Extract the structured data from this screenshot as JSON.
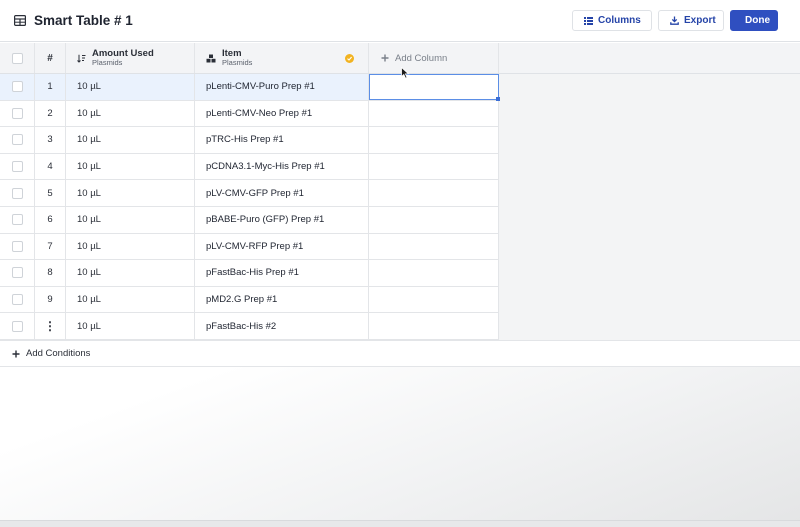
{
  "header": {
    "title": "Smart Table # 1",
    "columns_label": "Columns",
    "export_label": "Export",
    "done_label": "Done"
  },
  "table": {
    "columns": {
      "number": "#",
      "amount": {
        "label": "Amount Used",
        "sub": "Plasmids"
      },
      "item": {
        "label": "Item",
        "sub": "Plasmids"
      },
      "add_column": "Add Column"
    },
    "rows": [
      {
        "num": "1",
        "amount": "10 µL",
        "item": "pLenti-CMV-Puro Prep #1"
      },
      {
        "num": "2",
        "amount": "10 µL",
        "item": "pLenti-CMV-Neo Prep #1"
      },
      {
        "num": "3",
        "amount": "10 µL",
        "item": "pTRC-His Prep #1"
      },
      {
        "num": "4",
        "amount": "10 µL",
        "item": "pCDNA3.1-Myc-His Prep #1"
      },
      {
        "num": "5",
        "amount": "10 µL",
        "item": "pLV-CMV-GFP Prep #1"
      },
      {
        "num": "6",
        "amount": "10 µL",
        "item": "pBABE-Puro (GFP) Prep #1"
      },
      {
        "num": "7",
        "amount": "10 µL",
        "item": "pLV-CMV-RFP Prep #1"
      },
      {
        "num": "8",
        "amount": "10 µL",
        "item": "pFastBac-His Prep #1"
      },
      {
        "num": "9",
        "amount": "10 µL",
        "item": "pMD2.G Prep #1"
      },
      {
        "num": "⋮",
        "amount": "10 µL",
        "item": "pFastBac-His #2"
      }
    ],
    "add_conditions_label": "Add Conditions"
  },
  "colors": {
    "accent": "#2f4fc0",
    "selected_row": "#eaf2fd",
    "verified_badge": "#f2b321"
  }
}
